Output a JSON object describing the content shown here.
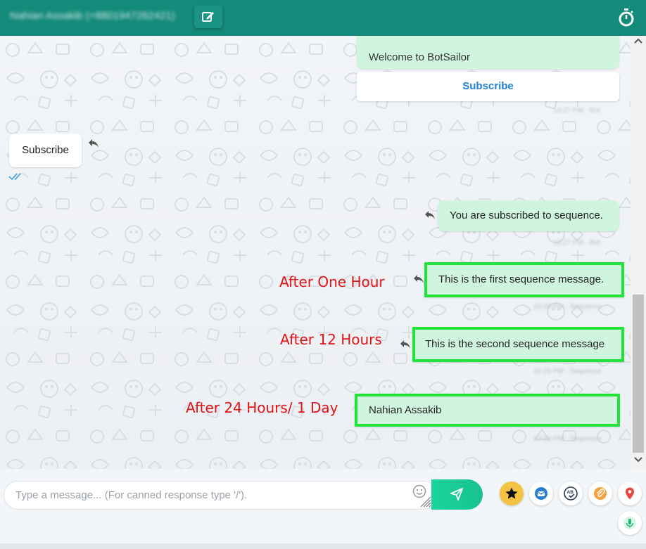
{
  "header": {
    "contact_name": "Nahian Assakib (+8801947262421)"
  },
  "messages": {
    "welcome_text": "Welcome to BotSailor",
    "subscribe_button": "Subscribe",
    "welcome_meta": "10:27 PM · Bot",
    "incoming_subscribe": "Subscribe",
    "subscribed_text": "You are subscribed to sequence.",
    "subscribed_meta": "10:27 PM · Bot",
    "first_sequence": "This is the first sequence message.",
    "first_meta": "10:28 PM · Sequence",
    "second_sequence": "This is the second sequence message",
    "second_meta": "10:29 PM · Sequence",
    "third_sequence": "Nahian Assakib",
    "third_meta": "10:30 PM · Sequence"
  },
  "annotations": {
    "after_one_hour": "After One Hour",
    "after_12_hours": "After 12 Hours",
    "after_24_hours": "After 24 Hours/ 1 Day"
  },
  "composer": {
    "placeholder": "Type a message... (For canned response type '/')."
  },
  "colors": {
    "header": "#148a7a",
    "outgoing_bubble": "#cff5df",
    "highlight_border": "#22e33a",
    "annotation": "#e01414",
    "send_button": "#1bd49a"
  },
  "icons": [
    "edit-icon",
    "timer-icon",
    "reply-icon",
    "double-check-icon",
    "emoji-icon",
    "send-icon",
    "star-icon",
    "envelope-icon",
    "spellcheck-icon",
    "paperclip-icon",
    "location-icon",
    "microphone-icon"
  ]
}
